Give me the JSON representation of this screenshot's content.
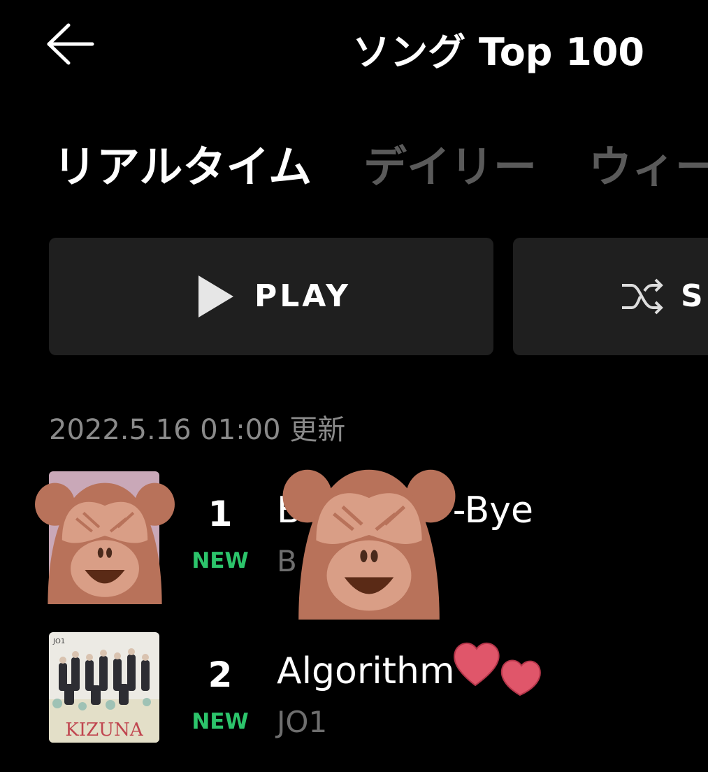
{
  "header": {
    "title": "ソング Top 100",
    "back_icon": "arrow-left-icon"
  },
  "tabs": [
    {
      "label": "リアルタイム",
      "selected": true
    },
    {
      "label": "デイリー",
      "selected": false
    },
    {
      "label": "ウィー",
      "selected": false
    }
  ],
  "actions": {
    "play_label": "PLAY",
    "shuffle_label": "S"
  },
  "update_time": "2022.5.16 01:00 更新",
  "songs": [
    {
      "rank": "1",
      "badge": "NEW",
      "title_visible_start": "B",
      "title_visible_end": "-Bye",
      "artist_visible": "B"
    },
    {
      "rank": "2",
      "badge": "NEW",
      "title": "Algorithm",
      "artist": "JO1",
      "album_text": "KIZUNA",
      "album_top_text": "JO1"
    }
  ],
  "colors": {
    "background": "#000000",
    "button_bg": "#1f1f1f",
    "new_badge": "#2cc46b",
    "inactive_tab": "#5a5a5a",
    "secondary_text": "#8a8a8a",
    "heart": "#e0566a",
    "monkey": "#b8725a"
  }
}
